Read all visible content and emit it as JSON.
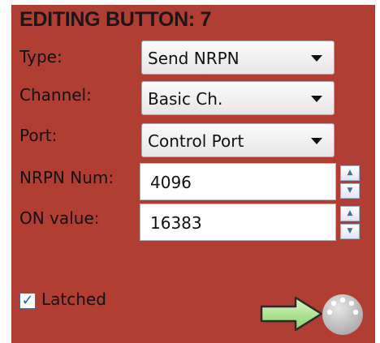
{
  "panel": {
    "title": "EDITING BUTTON: 7"
  },
  "fields": {
    "type": {
      "label": "Type:",
      "value": "Send NRPN"
    },
    "channel": {
      "label": "Channel:",
      "value": "Basic Ch."
    },
    "port": {
      "label": "Port:",
      "value": "Control Port"
    },
    "nrpn_num": {
      "label": "NRPN Num:",
      "value": "4096"
    },
    "on_value": {
      "label": "ON value:",
      "value": "16383"
    }
  },
  "latched": {
    "label": "Latched",
    "checked": true
  },
  "icons": {
    "dropdown": "chevron-down-icon",
    "spin_up": "spin-up-icon",
    "spin_down": "spin-down-icon",
    "send": "green-arrow-right-icon",
    "midi": "midi-connector-icon"
  },
  "colors": {
    "panel_bg": "#b03e33",
    "arrow_green": "#9ee07c",
    "midi_gray": "#c4c4c4"
  }
}
